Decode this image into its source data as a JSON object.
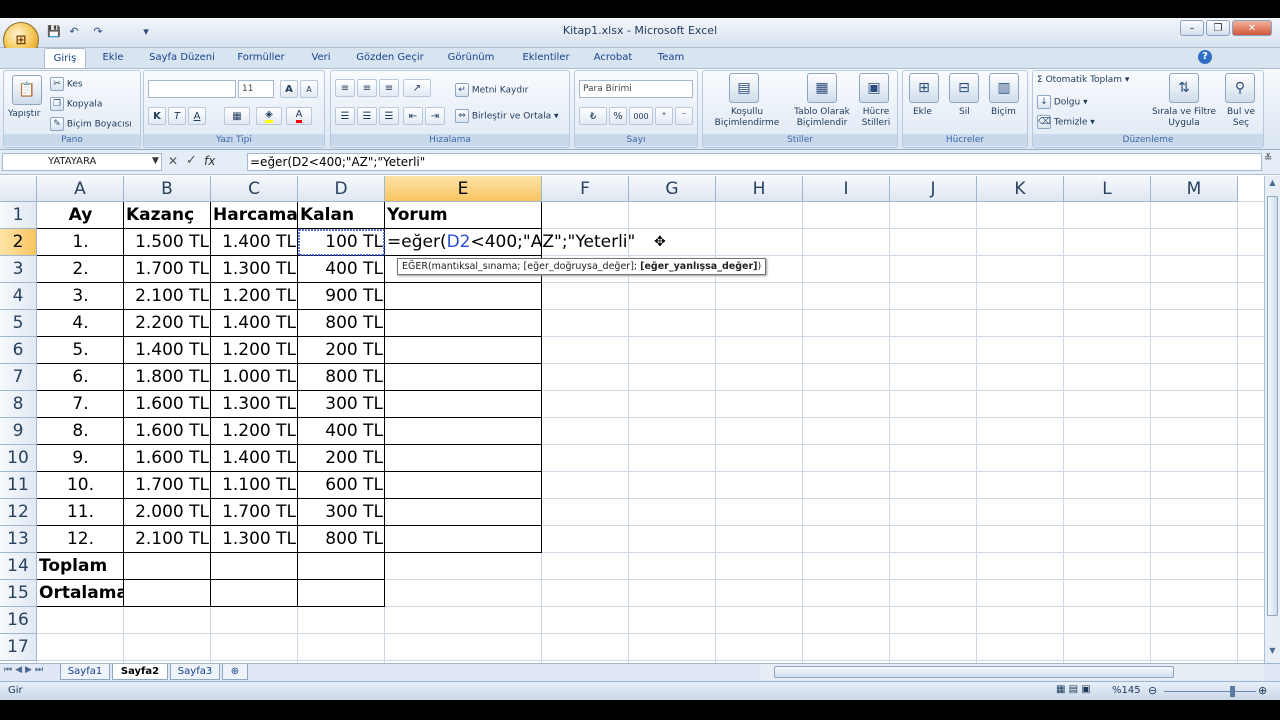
{
  "window": {
    "title": "Kitap1.xlsx - Microsoft Excel"
  },
  "office_button": {
    "glyph": "⊞"
  },
  "qat": {
    "save_glyph": "💾",
    "undo_glyph": "↶",
    "redo_glyph": "↷",
    "customize_glyph": "▾"
  },
  "window_controls": {
    "min": "–",
    "restore": "❐",
    "close": "✕"
  },
  "tabs": [
    "Giriş",
    "Ekle",
    "Sayfa Düzeni",
    "Formüller",
    "Veri",
    "Gözden Geçir",
    "Görünüm",
    "Eklentiler",
    "Acrobat",
    "Team"
  ],
  "ribbon": {
    "pano": {
      "label": "Pano",
      "paste": "Yapıştır",
      "cut": "Kes",
      "copy": "Kopyala",
      "format_painter": "Biçim Boyacısı"
    },
    "font": {
      "label": "Yazı Tipi",
      "size": "11",
      "bold": "K",
      "italic": "T",
      "underline": "A",
      "grow": "A",
      "shrink": "A"
    },
    "align": {
      "label": "Hizalama",
      "wrap": "Metni Kaydır",
      "merge": "Birleştir ve Ortala"
    },
    "number": {
      "label": "Sayı",
      "format": "Para Birimi",
      "percent": "%",
      "comma": "000"
    },
    "styles": {
      "label": "Stiller",
      "conditional": "Koşullu Biçimlendirme",
      "table": "Tablo Olarak Biçimlendir",
      "cell": "Hücre Stilleri"
    },
    "cells": {
      "label": "Hücreler",
      "insert": "Ekle",
      "delete": "Sil",
      "format": "Biçim"
    },
    "editing": {
      "label": "Düzenleme",
      "autosum": "Otomatik Toplam",
      "fill": "Dolgu",
      "clear": "Temizle",
      "sort": "Sırala ve Filtre Uygula",
      "find": "Bul ve Seç"
    }
  },
  "formula_bar": {
    "name_box": "YATAYARA",
    "formula": "=eğer(D2<400;\"AZ\";\"Yeterli\""
  },
  "columns": [
    "A",
    "B",
    "C",
    "D",
    "E",
    "F",
    "G",
    "H",
    "I",
    "J",
    "K",
    "L",
    "M"
  ],
  "rows": [
    "1",
    "2",
    "3",
    "4",
    "5",
    "6",
    "7",
    "8",
    "9",
    "10",
    "11",
    "12",
    "13",
    "14",
    "15",
    "16",
    "17"
  ],
  "headers": {
    "a": "Ay",
    "b": "Kazanç",
    "c": "Harcama",
    "d": "Kalan",
    "e": "Yorum"
  },
  "data": [
    [
      "1.",
      "1.500 TL",
      "1.400 TL",
      "100 TL"
    ],
    [
      "2.",
      "1.700 TL",
      "1.300 TL",
      "400 TL"
    ],
    [
      "3.",
      "2.100 TL",
      "1.200 TL",
      "900 TL"
    ],
    [
      "4.",
      "2.200 TL",
      "1.400 TL",
      "800 TL"
    ],
    [
      "5.",
      "1.400 TL",
      "1.200 TL",
      "200 TL"
    ],
    [
      "6.",
      "1.800 TL",
      "1.000 TL",
      "800 TL"
    ],
    [
      "7.",
      "1.600 TL",
      "1.300 TL",
      "300 TL"
    ],
    [
      "8.",
      "1.600 TL",
      "1.200 TL",
      "400 TL"
    ],
    [
      "9.",
      "1.600 TL",
      "1.400 TL",
      "200 TL"
    ],
    [
      "10.",
      "1.700 TL",
      "1.100 TL",
      "600 TL"
    ],
    [
      "11.",
      "2.000 TL",
      "1.700 TL",
      "300 TL"
    ],
    [
      "12.",
      "2.100 TL",
      "1.300 TL",
      "800 TL"
    ]
  ],
  "footer_labels": {
    "total": "Toplam",
    "average": "Ortalama"
  },
  "editing_cell": {
    "prefix": "=eğer(",
    "ref": "D2",
    "rest": "<400;\"AZ\";\"Yeterli\""
  },
  "tooltip": {
    "fn": "EĞER(mantıksal_sınama; [eğer_doğruysa_değer]; ",
    "bold_arg": "[eğer_yanlışsa_değer]",
    "close": ")"
  },
  "sheets": [
    "Sayfa1",
    "Sayfa2",
    "Sayfa3"
  ],
  "status": {
    "mode": "Gir",
    "zoom": "%145"
  }
}
